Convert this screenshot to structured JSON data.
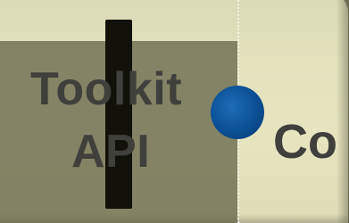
{
  "labels": {
    "left_line1": "Toolkit",
    "left_line2": "API",
    "right": "Co"
  },
  "colors": {
    "tile": "#e3e2bd",
    "shade": "#69684c",
    "bar": "#111109",
    "pip": "#0b4f94",
    "text": "#3f3f3c",
    "guide": "#f3f3ea"
  }
}
